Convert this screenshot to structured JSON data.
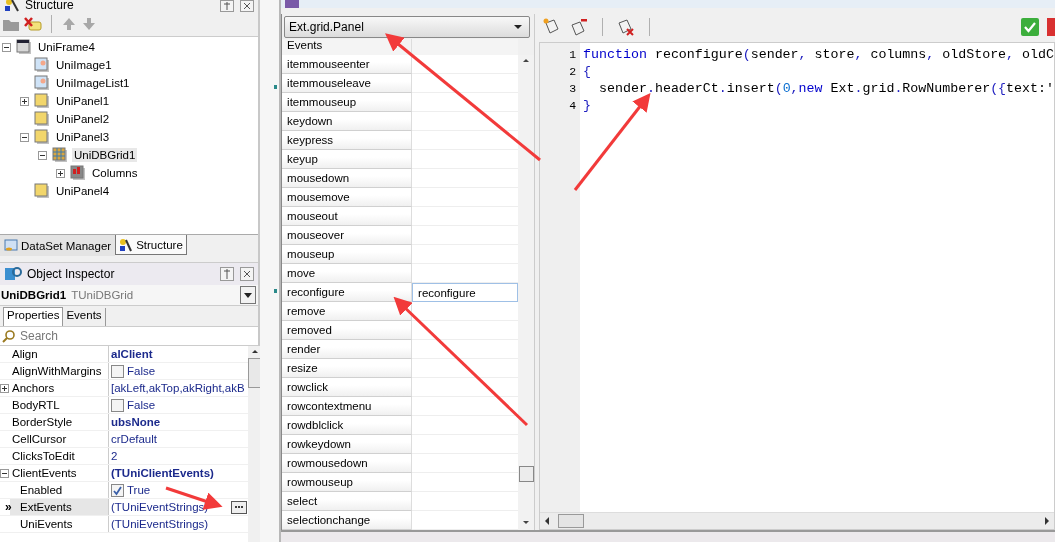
{
  "structure_panel": {
    "title": "Structure",
    "tree": [
      {
        "label": "UniFrame4",
        "kind": "frame",
        "expanded": true,
        "selected": false,
        "children": [
          {
            "label": "UniImage1",
            "kind": "image",
            "selected": false
          },
          {
            "label": "UniImageList1",
            "kind": "imagelist",
            "selected": false
          },
          {
            "label": "UniPanel1",
            "kind": "panel",
            "expanded": false,
            "selected": false
          },
          {
            "label": "UniPanel2",
            "kind": "panel",
            "selected": false
          },
          {
            "label": "UniPanel3",
            "kind": "panel",
            "expanded": true,
            "selected": false,
            "children": [
              {
                "label": "UniDBGrid1",
                "kind": "grid",
                "expanded": true,
                "selected": true,
                "children": [
                  {
                    "label": "Columns",
                    "kind": "columns",
                    "expanded": false,
                    "selected": false
                  }
                ]
              }
            ]
          },
          {
            "label": "UniPanel4",
            "kind": "panel",
            "selected": false
          }
        ]
      }
    ],
    "tabs": [
      {
        "label": "DataSet Manager",
        "selected": false
      },
      {
        "label": "Structure",
        "selected": true
      }
    ]
  },
  "object_inspector": {
    "title": "Object Inspector",
    "component": {
      "name": "UniDBGrid1",
      "type": "TUniDBGrid"
    },
    "tabs": [
      {
        "label": "Properties",
        "selected": true
      },
      {
        "label": "Events",
        "selected": false
      }
    ],
    "search": {
      "placeholder": "Search"
    },
    "properties": [
      {
        "name": "Align",
        "value": "alClient",
        "kind": "bold",
        "selected": false
      },
      {
        "name": "AlignWithMargins",
        "value": "False",
        "kind": "check",
        "checked": false,
        "selected": false
      },
      {
        "name": "Anchors",
        "value": "[akLeft,akTop,akRight,akB",
        "kind": "plain",
        "expanded": false,
        "selected": false
      },
      {
        "name": "BodyRTL",
        "value": "False",
        "kind": "check",
        "checked": false,
        "selected": false
      },
      {
        "name": "BorderStyle",
        "value": "ubsNone",
        "kind": "bold",
        "selected": false
      },
      {
        "name": "CellCursor",
        "value": "crDefault",
        "kind": "plain",
        "selected": false
      },
      {
        "name": "ClicksToEdit",
        "value": "2",
        "kind": "plain",
        "selected": false
      },
      {
        "name": "ClientEvents",
        "value": "(TUniClientEvents)",
        "kind": "bold",
        "expanded": true,
        "selected": false,
        "children": [
          {
            "name": "Enabled",
            "value": "True",
            "kind": "check",
            "checked": true,
            "selected": false
          },
          {
            "name": "ExtEvents",
            "value": "(TUniEventStrings)",
            "kind": "dialog",
            "selected": true,
            "row_marker": "»"
          },
          {
            "name": "UniEvents",
            "value": "(TUniEventStrings)",
            "kind": "plain",
            "selected": false
          }
        ]
      }
    ]
  },
  "events_editor": {
    "class_combo": "Ext.grid.Panel",
    "list_header": "Events",
    "events": [
      {
        "name": "itemmouseenter",
        "selected": false
      },
      {
        "name": "itemmouseleave",
        "selected": false
      },
      {
        "name": "itemmouseup",
        "selected": false
      },
      {
        "name": "keydown",
        "selected": false
      },
      {
        "name": "keypress",
        "selected": false
      },
      {
        "name": "keyup",
        "selected": false
      },
      {
        "name": "mousedown",
        "selected": false
      },
      {
        "name": "mousemove",
        "selected": false
      },
      {
        "name": "mouseout",
        "selected": false
      },
      {
        "name": "mouseover",
        "selected": false
      },
      {
        "name": "mouseup",
        "selected": false
      },
      {
        "name": "move",
        "selected": false
      },
      {
        "name": "reconfigure",
        "handler": "reconfigure",
        "selected": true
      },
      {
        "name": "remove",
        "selected": false
      },
      {
        "name": "removed",
        "selected": false
      },
      {
        "name": "render",
        "selected": false
      },
      {
        "name": "resize",
        "selected": false
      },
      {
        "name": "rowclick",
        "selected": false
      },
      {
        "name": "rowcontextmenu",
        "selected": false
      },
      {
        "name": "rowdblclick",
        "selected": false
      },
      {
        "name": "rowkeydown",
        "selected": false
      },
      {
        "name": "rowmousedown",
        "selected": false
      },
      {
        "name": "rowmouseup",
        "selected": false
      },
      {
        "name": "select",
        "selected": false
      },
      {
        "name": "selectionchange",
        "selected": false
      }
    ],
    "code": [
      {
        "number": "1",
        "tokens": [
          {
            "text": "function",
            "kind": "keyword"
          },
          {
            "text": " reconfigure",
            "kind": "plain"
          },
          {
            "text": "(",
            "kind": "punct"
          },
          {
            "text": "sender",
            "kind": "plain"
          },
          {
            "text": ", ",
            "kind": "punct"
          },
          {
            "text": "store",
            "kind": "plain"
          },
          {
            "text": ", ",
            "kind": "punct"
          },
          {
            "text": "columns",
            "kind": "plain"
          },
          {
            "text": ", ",
            "kind": "punct"
          },
          {
            "text": "oldStore",
            "kind": "plain"
          },
          {
            "text": ", ",
            "kind": "punct"
          },
          {
            "text": "oldC",
            "kind": "plain"
          }
        ]
      },
      {
        "number": "2",
        "tokens": [
          {
            "text": "{",
            "kind": "punct"
          }
        ]
      },
      {
        "number": "3",
        "tokens": [
          {
            "text": "  sender",
            "kind": "plain"
          },
          {
            "text": ".",
            "kind": "punct"
          },
          {
            "text": "headerCt",
            "kind": "plain"
          },
          {
            "text": ".",
            "kind": "punct"
          },
          {
            "text": "insert",
            "kind": "plain"
          },
          {
            "text": "(",
            "kind": "punct"
          },
          {
            "text": "0",
            "kind": "number"
          },
          {
            "text": ",",
            "kind": "punct"
          },
          {
            "text": "new",
            "kind": "keyword"
          },
          {
            "text": " Ext",
            "kind": "plain"
          },
          {
            "text": ".",
            "kind": "punct"
          },
          {
            "text": "grid",
            "kind": "plain"
          },
          {
            "text": ".",
            "kind": "punct"
          },
          {
            "text": "RowNumberer",
            "kind": "plain"
          },
          {
            "text": "({",
            "kind": "punct"
          },
          {
            "text": "text:'",
            "kind": "plain"
          }
        ]
      },
      {
        "number": "4",
        "tokens": [
          {
            "text": "}",
            "kind": "punct"
          }
        ]
      }
    ]
  }
}
